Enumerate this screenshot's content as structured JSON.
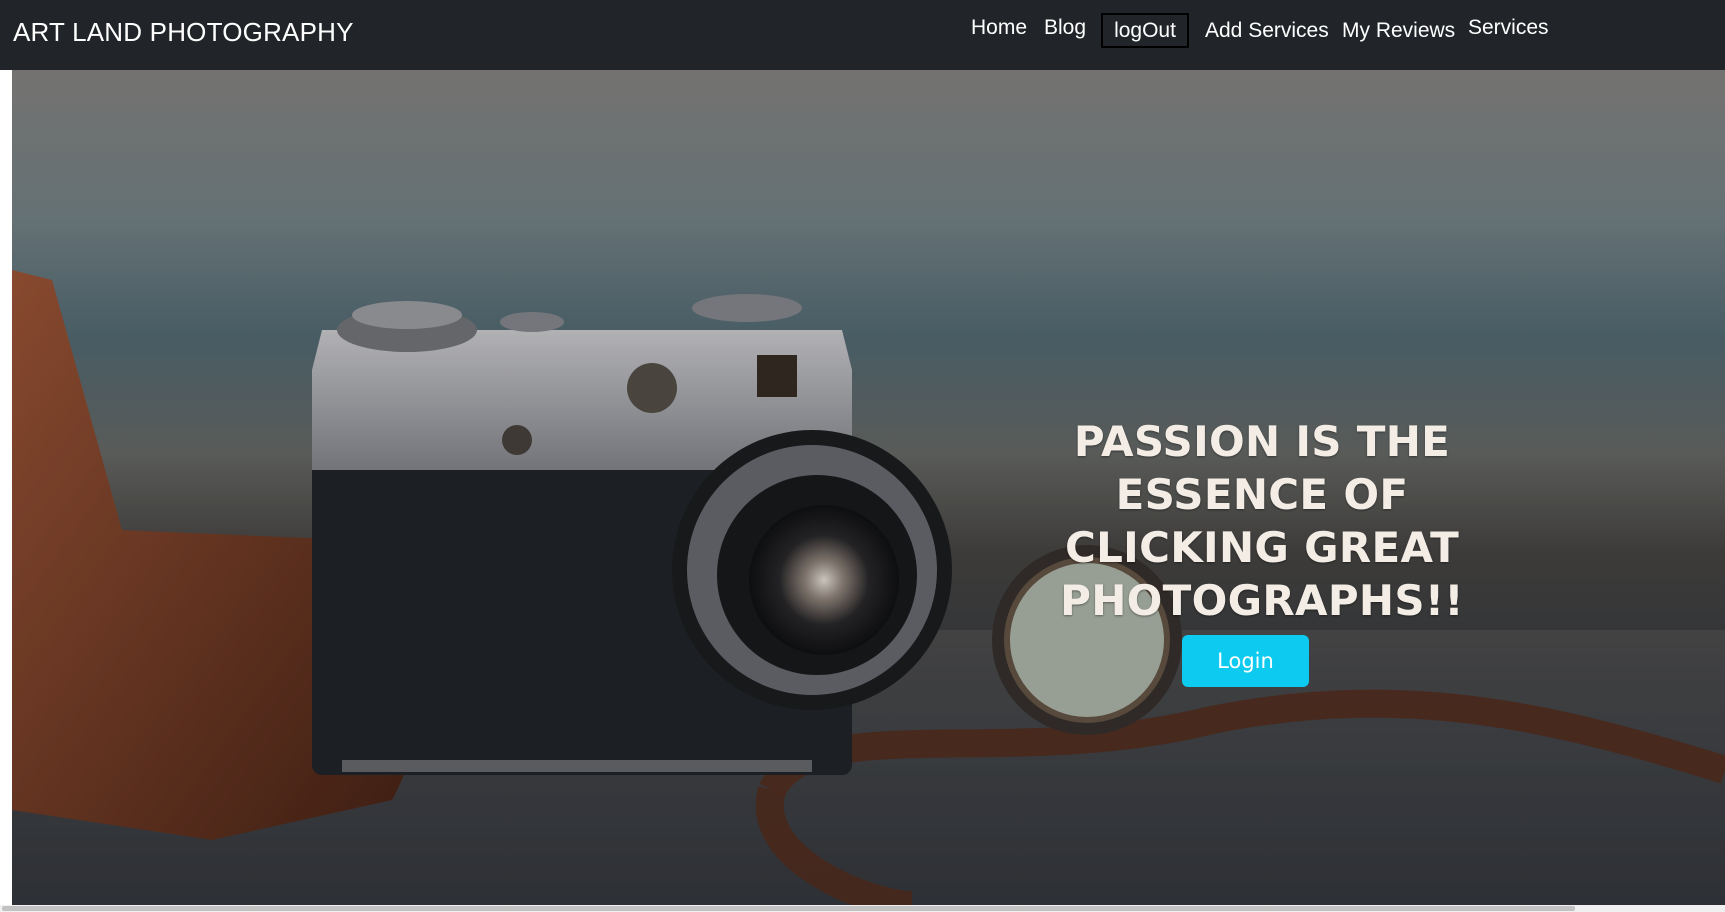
{
  "navbar": {
    "brand": "ART LAND PHOTOGRAPHY",
    "links": {
      "home": "Home",
      "blog": "Blog",
      "logout": "logOut",
      "add_services": "Add Services",
      "my_reviews": "My Reviews",
      "services": "Services"
    },
    "background": "#212529"
  },
  "hero": {
    "heading": "PASSION IS THE ESSENCE OF CLICKING GREAT PHOTOGRAPHS!!",
    "login_label": "Login",
    "button_color": "#0dcaf0",
    "image": "vintage-camera-photo"
  }
}
